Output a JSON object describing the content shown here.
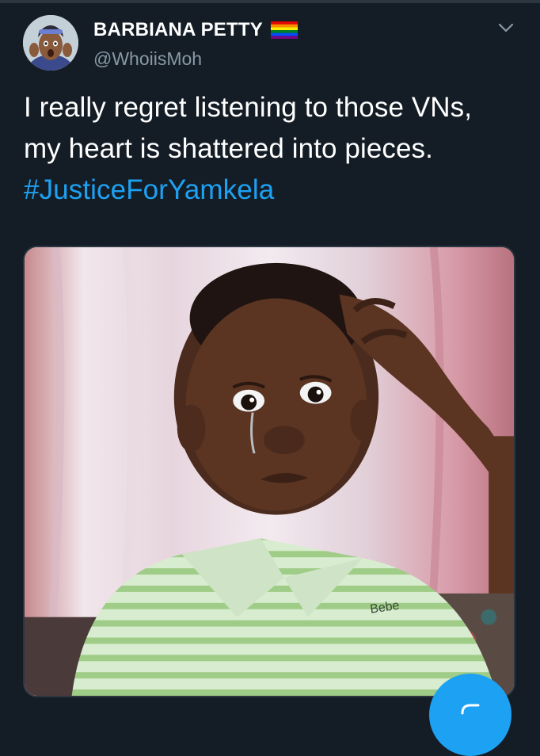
{
  "tweet": {
    "display_name": "BARBIANA PETTY",
    "handle": "@WhoiisMoh",
    "text_plain": "I really regret listening to those VNs, my heart is shattered into pieces. ",
    "hashtag": "#JusticeForYamkela",
    "flag_icon": "rainbow-flag-icon",
    "menu_icon": "chevron-down-icon"
  },
  "media": {
    "shirt_text": "Bebe"
  },
  "compose": {
    "icon": "compose-icon"
  },
  "colors": {
    "background": "#141d26",
    "text": "#ffffff",
    "secondary_text": "#8899a6",
    "link": "#1da1f2"
  }
}
